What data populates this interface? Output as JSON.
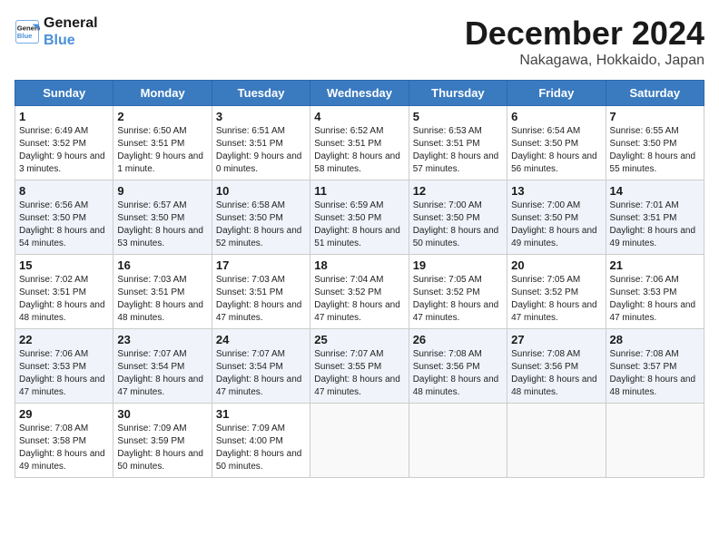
{
  "logo": {
    "line1": "General",
    "line2": "Blue"
  },
  "title": "December 2024",
  "subtitle": "Nakagawa, Hokkaido, Japan",
  "days_of_week": [
    "Sunday",
    "Monday",
    "Tuesday",
    "Wednesday",
    "Thursday",
    "Friday",
    "Saturday"
  ],
  "weeks": [
    [
      {
        "day": 1,
        "sunrise": "6:49 AM",
        "sunset": "3:52 PM",
        "daylight": "9 hours and 3 minutes."
      },
      {
        "day": 2,
        "sunrise": "6:50 AM",
        "sunset": "3:51 PM",
        "daylight": "9 hours and 1 minute."
      },
      {
        "day": 3,
        "sunrise": "6:51 AM",
        "sunset": "3:51 PM",
        "daylight": "9 hours and 0 minutes."
      },
      {
        "day": 4,
        "sunrise": "6:52 AM",
        "sunset": "3:51 PM",
        "daylight": "8 hours and 58 minutes."
      },
      {
        "day": 5,
        "sunrise": "6:53 AM",
        "sunset": "3:51 PM",
        "daylight": "8 hours and 57 minutes."
      },
      {
        "day": 6,
        "sunrise": "6:54 AM",
        "sunset": "3:50 PM",
        "daylight": "8 hours and 56 minutes."
      },
      {
        "day": 7,
        "sunrise": "6:55 AM",
        "sunset": "3:50 PM",
        "daylight": "8 hours and 55 minutes."
      }
    ],
    [
      {
        "day": 8,
        "sunrise": "6:56 AM",
        "sunset": "3:50 PM",
        "daylight": "8 hours and 54 minutes."
      },
      {
        "day": 9,
        "sunrise": "6:57 AM",
        "sunset": "3:50 PM",
        "daylight": "8 hours and 53 minutes."
      },
      {
        "day": 10,
        "sunrise": "6:58 AM",
        "sunset": "3:50 PM",
        "daylight": "8 hours and 52 minutes."
      },
      {
        "day": 11,
        "sunrise": "6:59 AM",
        "sunset": "3:50 PM",
        "daylight": "8 hours and 51 minutes."
      },
      {
        "day": 12,
        "sunrise": "7:00 AM",
        "sunset": "3:50 PM",
        "daylight": "8 hours and 50 minutes."
      },
      {
        "day": 13,
        "sunrise": "7:00 AM",
        "sunset": "3:50 PM",
        "daylight": "8 hours and 49 minutes."
      },
      {
        "day": 14,
        "sunrise": "7:01 AM",
        "sunset": "3:51 PM",
        "daylight": "8 hours and 49 minutes."
      }
    ],
    [
      {
        "day": 15,
        "sunrise": "7:02 AM",
        "sunset": "3:51 PM",
        "daylight": "8 hours and 48 minutes."
      },
      {
        "day": 16,
        "sunrise": "7:03 AM",
        "sunset": "3:51 PM",
        "daylight": "8 hours and 48 minutes."
      },
      {
        "day": 17,
        "sunrise": "7:03 AM",
        "sunset": "3:51 PM",
        "daylight": "8 hours and 47 minutes."
      },
      {
        "day": 18,
        "sunrise": "7:04 AM",
        "sunset": "3:52 PM",
        "daylight": "8 hours and 47 minutes."
      },
      {
        "day": 19,
        "sunrise": "7:05 AM",
        "sunset": "3:52 PM",
        "daylight": "8 hours and 47 minutes."
      },
      {
        "day": 20,
        "sunrise": "7:05 AM",
        "sunset": "3:52 PM",
        "daylight": "8 hours and 47 minutes."
      },
      {
        "day": 21,
        "sunrise": "7:06 AM",
        "sunset": "3:53 PM",
        "daylight": "8 hours and 47 minutes."
      }
    ],
    [
      {
        "day": 22,
        "sunrise": "7:06 AM",
        "sunset": "3:53 PM",
        "daylight": "8 hours and 47 minutes."
      },
      {
        "day": 23,
        "sunrise": "7:07 AM",
        "sunset": "3:54 PM",
        "daylight": "8 hours and 47 minutes."
      },
      {
        "day": 24,
        "sunrise": "7:07 AM",
        "sunset": "3:54 PM",
        "daylight": "8 hours and 47 minutes."
      },
      {
        "day": 25,
        "sunrise": "7:07 AM",
        "sunset": "3:55 PM",
        "daylight": "8 hours and 47 minutes."
      },
      {
        "day": 26,
        "sunrise": "7:08 AM",
        "sunset": "3:56 PM",
        "daylight": "8 hours and 48 minutes."
      },
      {
        "day": 27,
        "sunrise": "7:08 AM",
        "sunset": "3:56 PM",
        "daylight": "8 hours and 48 minutes."
      },
      {
        "day": 28,
        "sunrise": "7:08 AM",
        "sunset": "3:57 PM",
        "daylight": "8 hours and 48 minutes."
      }
    ],
    [
      {
        "day": 29,
        "sunrise": "7:08 AM",
        "sunset": "3:58 PM",
        "daylight": "8 hours and 49 minutes."
      },
      {
        "day": 30,
        "sunrise": "7:09 AM",
        "sunset": "3:59 PM",
        "daylight": "8 hours and 50 minutes."
      },
      {
        "day": 31,
        "sunrise": "7:09 AM",
        "sunset": "4:00 PM",
        "daylight": "8 hours and 50 minutes."
      },
      null,
      null,
      null,
      null
    ]
  ]
}
